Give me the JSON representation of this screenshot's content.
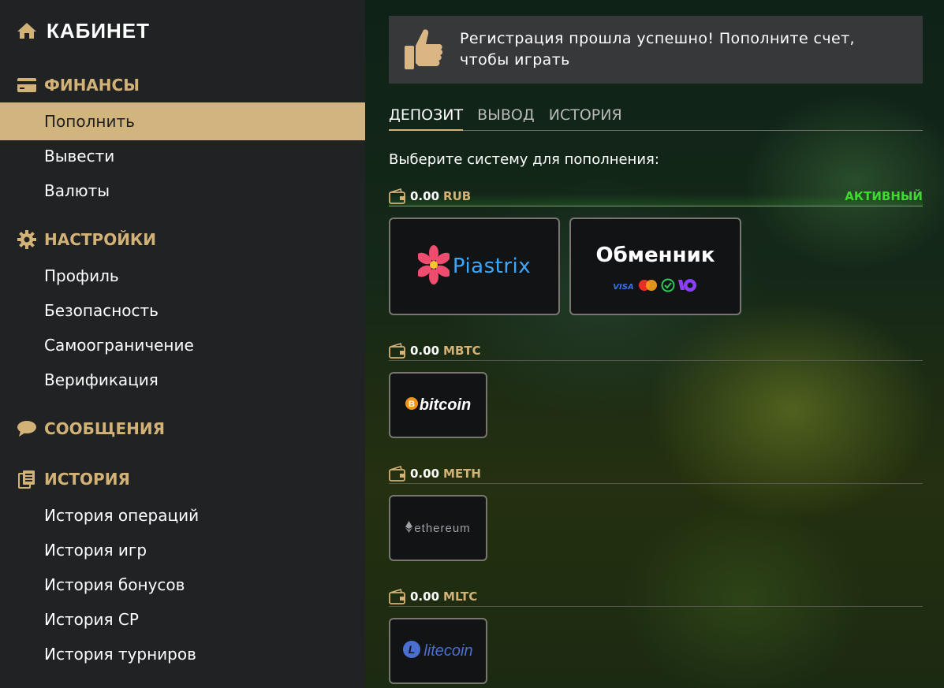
{
  "sidebar": {
    "title": "КАБИНЕТ",
    "sections": [
      {
        "label": "ФИНАНСЫ",
        "icon": "credit-card-icon",
        "items": [
          "Пополнить",
          "Вывести",
          "Валюты"
        ]
      },
      {
        "label": "НАСТРОЙКИ",
        "icon": "gear-icon",
        "items": [
          "Профиль",
          "Безопасность",
          "Самоограничение",
          "Верификация"
        ]
      },
      {
        "label": "СООБЩЕНИЯ",
        "icon": "chat-bubble-icon",
        "items": []
      },
      {
        "label": "ИСТОРИЯ",
        "icon": "documents-icon",
        "items": [
          "История операций",
          "История игр",
          "История бонусов",
          "История СР",
          "История турниров"
        ]
      }
    ],
    "active_item": "Пополнить"
  },
  "notice": {
    "message": "Регистрация прошла успешно! Пополните счет, чтобы играть",
    "icon": "thumbs-up-icon"
  },
  "tabs": [
    "ДЕПОЗИТ",
    "ВЫВОД",
    "ИСТОРИЯ"
  ],
  "active_tab": "ДЕПОЗИТ",
  "choose_label": "Выберите систему для пополнения:",
  "wallets": [
    {
      "amount": "0.00",
      "currency": "RUB",
      "status": "АКТИВНЫЙ",
      "methods": [
        "Piastrix",
        "Обменник"
      ]
    },
    {
      "amount": "0.00",
      "currency": "MBTC",
      "status": "",
      "methods": [
        "bitcoin"
      ]
    },
    {
      "amount": "0.00",
      "currency": "METH",
      "status": "",
      "methods": [
        "ethereum"
      ]
    },
    {
      "amount": "0.00",
      "currency": "MLTC",
      "status": "",
      "methods": [
        "litecoin"
      ]
    }
  ],
  "exchanger_badges": [
    "VISA"
  ],
  "colors": {
    "accent": "#d2b277",
    "active_green": "#3fd92f",
    "active_item_bg": "#d2b57e",
    "sidebar_bg": "#202224",
    "card_bg": "#121315"
  }
}
